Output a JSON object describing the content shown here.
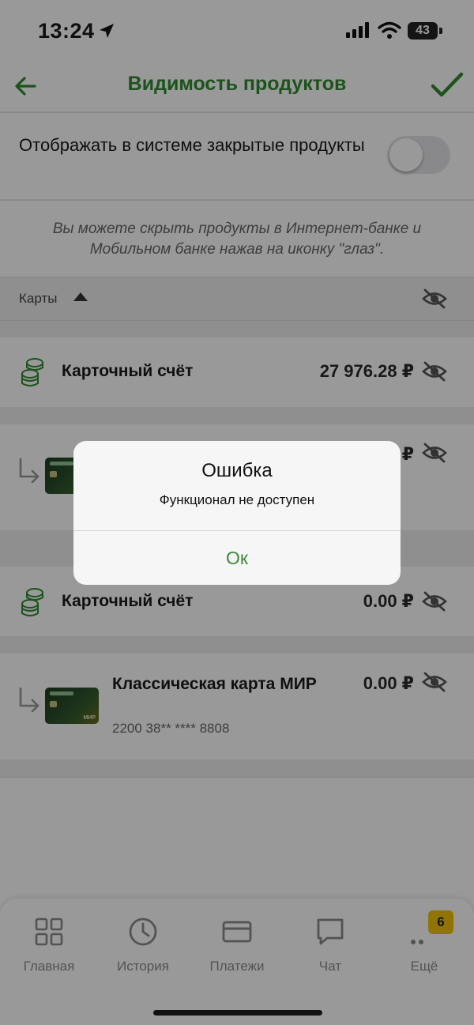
{
  "status_bar": {
    "time": "13:24",
    "battery": "43"
  },
  "header": {
    "title": "Видимость продуктов"
  },
  "settings": {
    "toggle_label": "Отображать в системе закрытые продукты",
    "toggle_on": false,
    "hint": "Вы можете скрыть продукты в Интернет-банке и Мобильном банке нажав на иконку \"глаз\"."
  },
  "section": {
    "title": "Карты"
  },
  "products": [
    {
      "type": "account",
      "name": "Карточный счёт",
      "amount": "27 976.28 ₽"
    },
    {
      "type": "card",
      "amount": "₽"
    },
    {
      "type": "account",
      "name": "Карточный счёт",
      "amount": "0.00 ₽"
    },
    {
      "type": "card",
      "name": "Классическая карта МИР",
      "number": "2200 38** **** 8808",
      "amount": "0.00 ₽"
    }
  ],
  "tabs": [
    {
      "label": "Главная",
      "icon": "grid-icon"
    },
    {
      "label": "История",
      "icon": "clock-icon"
    },
    {
      "label": "Платежи",
      "icon": "card-icon"
    },
    {
      "label": "Чат",
      "icon": "chat-icon"
    },
    {
      "label": "Ещё",
      "icon": "more-icon",
      "badge": "6"
    }
  ],
  "dialog": {
    "title": "Ошибка",
    "message": "Функционал не доступен",
    "button": "Ок"
  },
  "colors": {
    "accent": "#2f8a2f",
    "badge": "#f0c40a"
  }
}
